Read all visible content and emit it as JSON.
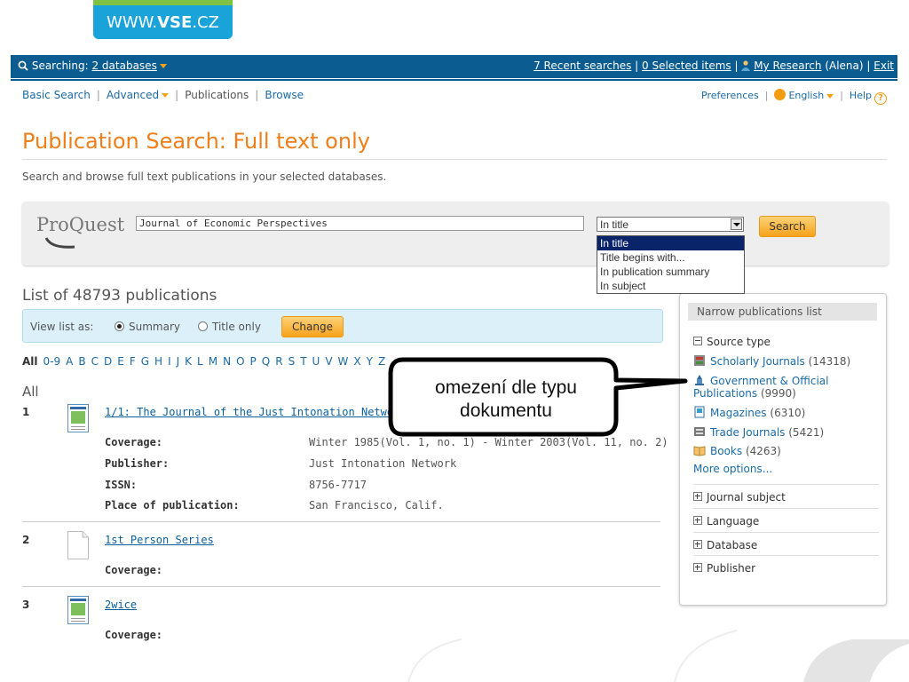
{
  "logo": {
    "prefix": "WWW.",
    "bold": "VSE",
    "suffix": ".CZ"
  },
  "topbar": {
    "searching_label": "Searching:",
    "databases_link": "2 databases",
    "recent_searches": "7 Recent searches",
    "selected_items": "0 Selected items",
    "my_research": "My Research",
    "user": "(Alena)",
    "exit": "Exit"
  },
  "nav": {
    "basic": "Basic Search",
    "advanced": "Advanced",
    "publications": "Publications",
    "browse": "Browse",
    "preferences": "Preferences",
    "language": "English",
    "help": "Help"
  },
  "page": {
    "title": "Publication Search: Full text only",
    "subtitle": "Search and browse full text publications in your selected databases."
  },
  "search": {
    "brand": "ProQuest",
    "query": "Journal of Economic Perspectives",
    "field_selected": "In title",
    "field_options": [
      "In title",
      "Title begins with...",
      "In publication summary",
      "In subject"
    ],
    "button": "Search"
  },
  "list": {
    "count_text": "List of 48793 publications",
    "view_label": "View list as:",
    "view_summary": "Summary",
    "view_title_only": "Title only",
    "change_button": "Change",
    "alpha": [
      "All",
      "0-9",
      "A",
      "B",
      "C",
      "D",
      "E",
      "F",
      "G",
      "H",
      "I",
      "J",
      "K",
      "L",
      "M",
      "N",
      "O",
      "P",
      "Q",
      "R",
      "S",
      "T",
      "U",
      "V",
      "W",
      "X",
      "Y",
      "Z"
    ],
    "section_heading": "All"
  },
  "results": [
    {
      "num": "1",
      "title": "1/1: The Journal of the Just Intonation Network",
      "coverage_label": "Coverage:",
      "coverage": "Winter 1985(Vol. 1, no. 1) - Winter 2003(Vol. 11, no. 2)",
      "publisher_label": "Publisher:",
      "publisher": "Just Intonation Network",
      "issn_label": "ISSN:",
      "issn": "8756-7717",
      "place_label": "Place of publication:",
      "place": "San Francisco, Calif."
    },
    {
      "num": "2",
      "title": "1st Person Series",
      "coverage_label": "Coverage:"
    },
    {
      "num": "3",
      "title": "2wice",
      "coverage_label": "Coverage:"
    }
  ],
  "narrow": {
    "heading": "Narrow publications list",
    "source_type": "Source type",
    "items": [
      {
        "name": "Scholarly Journals",
        "count": "(14318)",
        "icon": "scholarly-journal-icon"
      },
      {
        "name": "Government & Official",
        "name2": "Publications",
        "count": "(9990)",
        "icon": "government-icon"
      },
      {
        "name": "Magazines",
        "count": "(6310)",
        "icon": "magazine-icon"
      },
      {
        "name": "Trade Journals",
        "count": "(5421)",
        "icon": "trade-journal-icon"
      },
      {
        "name": "Books",
        "count": "(4263)",
        "icon": "book-icon"
      }
    ],
    "more_options": "More options...",
    "collapsed": [
      "Journal subject",
      "Language",
      "Database",
      "Publisher"
    ]
  },
  "callout": {
    "line1": "omezení dle typu",
    "line2": "dokumentu"
  },
  "colors": {
    "topbar": "#0b5d91",
    "title": "#ee7f1b",
    "button": "#f7a21b",
    "link": "#0a5f9e"
  }
}
